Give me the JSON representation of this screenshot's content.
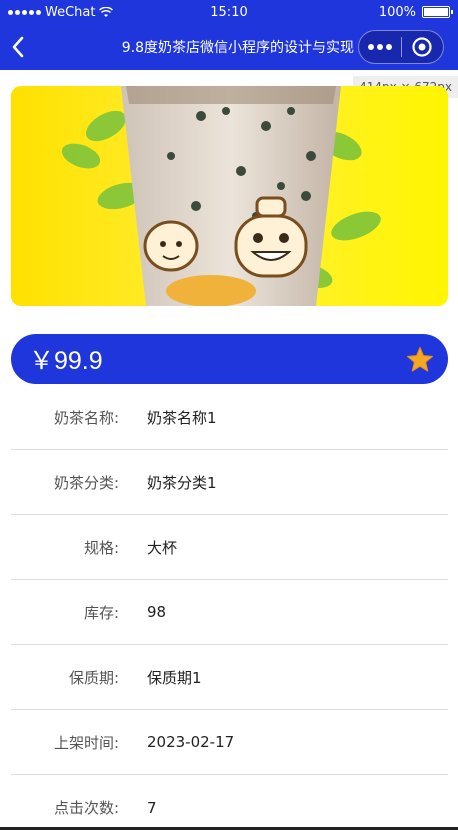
{
  "status_bar": {
    "carrier": "WeChat",
    "time": "15:10",
    "battery": "100%"
  },
  "nav": {
    "title": "9.8度奶茶店微信小程序的设计与实现",
    "back_icon": "chevron-left-icon",
    "more_icon": "more-dots-icon",
    "close_icon": "target-circle-icon"
  },
  "dev_size_tag": "414px × 672px",
  "product": {
    "price": "￥99.9",
    "favorite_icon": "star-icon",
    "favorite_color": "#f5a623"
  },
  "details": [
    {
      "label": "奶茶名称:",
      "value": "奶茶名称1"
    },
    {
      "label": "奶茶分类:",
      "value": "奶茶分类1"
    },
    {
      "label": "规格:",
      "value": "大杯"
    },
    {
      "label": "库存:",
      "value": "98"
    },
    {
      "label": "保质期:",
      "value": "保质期1"
    },
    {
      "label": "上架时间:",
      "value": "2023-02-17"
    },
    {
      "label": "点击次数:",
      "value": "7"
    }
  ],
  "colors": {
    "primary": "#1f36dc",
    "hero_background": "#ffe800"
  }
}
